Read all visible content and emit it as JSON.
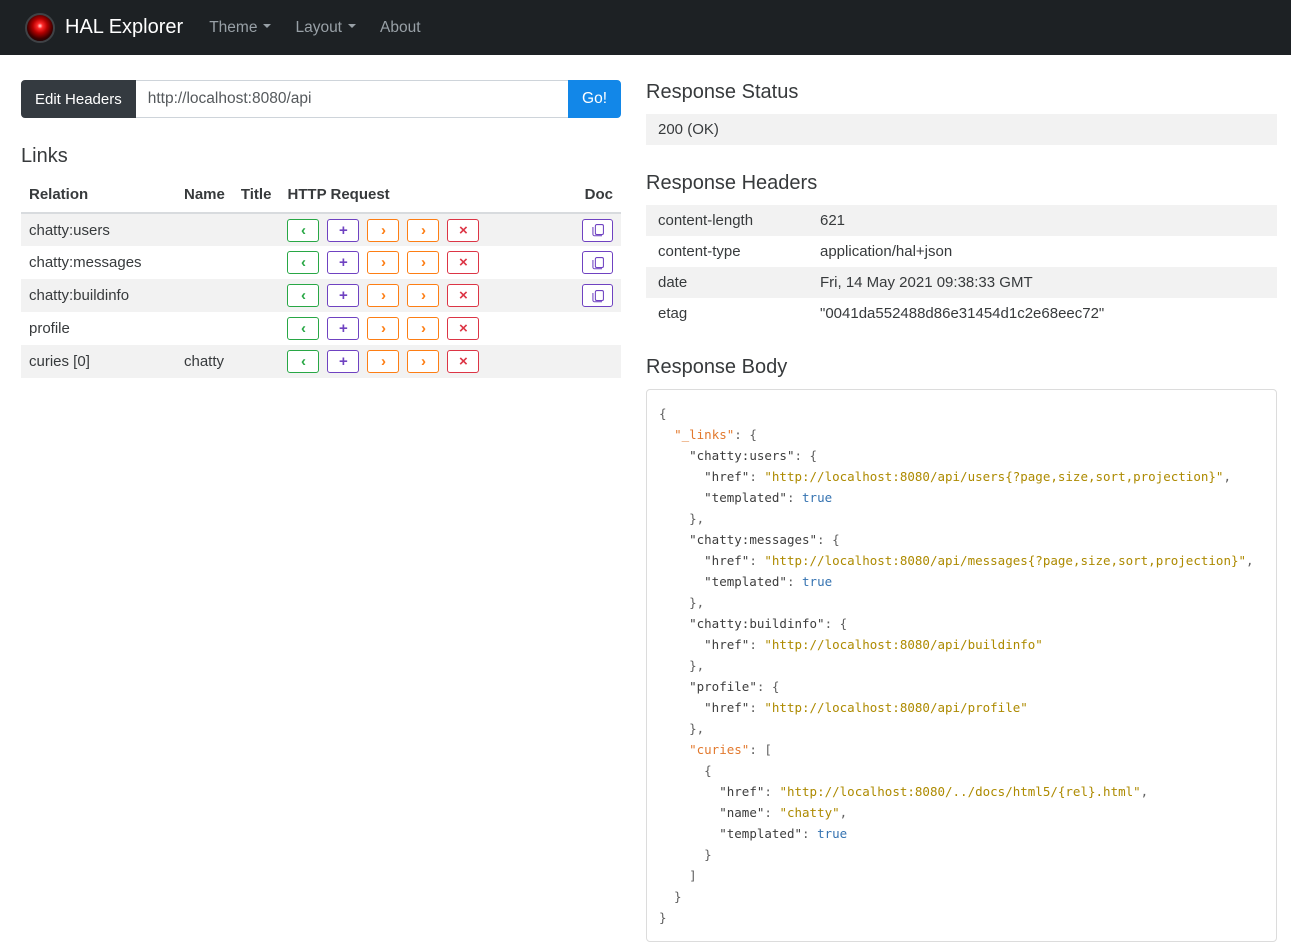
{
  "navbar": {
    "brand": "HAL Explorer",
    "items": [
      {
        "label": "Theme",
        "dropdown": true
      },
      {
        "label": "Layout",
        "dropdown": true
      },
      {
        "label": "About",
        "dropdown": false
      }
    ]
  },
  "address_bar": {
    "edit_headers_label": "Edit Headers",
    "url_value": "http://localhost:8080/api",
    "go_label": "Go!"
  },
  "links_section": {
    "title": "Links",
    "columns": [
      "Relation",
      "Name",
      "Title",
      "HTTP Request",
      "Doc"
    ],
    "http_buttons": [
      {
        "name": "get-button",
        "glyph": "‹",
        "color": "#28a745"
      },
      {
        "name": "post-button",
        "glyph": "+",
        "color": "#6f42c1"
      },
      {
        "name": "put-button",
        "glyph": "›",
        "color": "#fd7e14"
      },
      {
        "name": "patch-button",
        "glyph": "›",
        "color": "#fd7e14"
      },
      {
        "name": "delete-button",
        "glyph": "×",
        "color": "#dc3545"
      }
    ],
    "doc_button_color": "#6f42c1",
    "rows": [
      {
        "relation": "chatty:users",
        "name": "",
        "title": "",
        "doc": true
      },
      {
        "relation": "chatty:messages",
        "name": "",
        "title": "",
        "doc": true
      },
      {
        "relation": "chatty:buildinfo",
        "name": "",
        "title": "",
        "doc": true
      },
      {
        "relation": "profile",
        "name": "",
        "title": "",
        "doc": false
      },
      {
        "relation": "curies [0]",
        "name": "chatty",
        "title": "",
        "doc": false
      }
    ]
  },
  "response_status": {
    "title": "Response Status",
    "value": "200 (OK)"
  },
  "response_headers": {
    "title": "Response Headers",
    "rows": [
      {
        "key": "content-length",
        "value": "621"
      },
      {
        "key": "content-type",
        "value": "application/hal+json"
      },
      {
        "key": "date",
        "value": "Fri, 14 May 2021 09:38:33 GMT"
      },
      {
        "key": "etag",
        "value": "\"0041da552488d86e31454d1c2e68eec72\""
      }
    ]
  },
  "response_body": {
    "title": "Response Body",
    "token_colors": {
      "p": "#5f5f5f",
      "k": "#3d3d3d",
      "r": "#e2792e",
      "s": "#ad8a00",
      "b": "#3573b1"
    },
    "lines": [
      [
        [
          "p",
          "{"
        ]
      ],
      [
        [
          "p",
          "  "
        ],
        [
          "r",
          "\"_links\""
        ],
        [
          "p",
          ": {"
        ]
      ],
      [
        [
          "p",
          "    "
        ],
        [
          "k",
          "\"chatty:users\""
        ],
        [
          "p",
          ": {"
        ]
      ],
      [
        [
          "p",
          "      "
        ],
        [
          "k",
          "\"href\""
        ],
        [
          "p",
          ": "
        ],
        [
          "s",
          "\"http://localhost:8080/api/users{?page,size,sort,projection}\""
        ],
        [
          "p",
          ","
        ]
      ],
      [
        [
          "p",
          "      "
        ],
        [
          "k",
          "\"templated\""
        ],
        [
          "p",
          ": "
        ],
        [
          "b",
          "true"
        ]
      ],
      [
        [
          "p",
          "    },"
        ]
      ],
      [
        [
          "p",
          "    "
        ],
        [
          "k",
          "\"chatty:messages\""
        ],
        [
          "p",
          ": {"
        ]
      ],
      [
        [
          "p",
          "      "
        ],
        [
          "k",
          "\"href\""
        ],
        [
          "p",
          ": "
        ],
        [
          "s",
          "\"http://localhost:8080/api/messages{?page,size,sort,projection}\""
        ],
        [
          "p",
          ","
        ]
      ],
      [
        [
          "p",
          "      "
        ],
        [
          "k",
          "\"templated\""
        ],
        [
          "p",
          ": "
        ],
        [
          "b",
          "true"
        ]
      ],
      [
        [
          "p",
          "    },"
        ]
      ],
      [
        [
          "p",
          "    "
        ],
        [
          "k",
          "\"chatty:buildinfo\""
        ],
        [
          "p",
          ": {"
        ]
      ],
      [
        [
          "p",
          "      "
        ],
        [
          "k",
          "\"href\""
        ],
        [
          "p",
          ": "
        ],
        [
          "s",
          "\"http://localhost:8080/api/buildinfo\""
        ]
      ],
      [
        [
          "p",
          "    },"
        ]
      ],
      [
        [
          "p",
          "    "
        ],
        [
          "k",
          "\"profile\""
        ],
        [
          "p",
          ": {"
        ]
      ],
      [
        [
          "p",
          "      "
        ],
        [
          "k",
          "\"href\""
        ],
        [
          "p",
          ": "
        ],
        [
          "s",
          "\"http://localhost:8080/api/profile\""
        ]
      ],
      [
        [
          "p",
          "    },"
        ]
      ],
      [
        [
          "p",
          "    "
        ],
        [
          "r",
          "\"curies\""
        ],
        [
          "p",
          ": ["
        ]
      ],
      [
        [
          "p",
          "      {"
        ]
      ],
      [
        [
          "p",
          "        "
        ],
        [
          "k",
          "\"href\""
        ],
        [
          "p",
          ": "
        ],
        [
          "s",
          "\"http://localhost:8080/../docs/html5/{rel}.html\""
        ],
        [
          "p",
          ","
        ]
      ],
      [
        [
          "p",
          "        "
        ],
        [
          "k",
          "\"name\""
        ],
        [
          "p",
          ": "
        ],
        [
          "s",
          "\"chatty\""
        ],
        [
          "p",
          ","
        ]
      ],
      [
        [
          "p",
          "        "
        ],
        [
          "k",
          "\"templated\""
        ],
        [
          "p",
          ": "
        ],
        [
          "b",
          "true"
        ]
      ],
      [
        [
          "p",
          "      }"
        ]
      ],
      [
        [
          "p",
          "    ]"
        ]
      ],
      [
        [
          "p",
          "  }"
        ]
      ],
      [
        [
          "p",
          "}"
        ]
      ]
    ]
  },
  "colors": {
    "navbar_bg": "#1d2124",
    "primary": "#1287e8",
    "edit_headers_bg": "#343a40",
    "stripe": "#f2f2f2",
    "get": "#28a745",
    "post": "#6f42c1",
    "put": "#fd7e14",
    "patch": "#fd7e14",
    "delete": "#dc3545",
    "doc": "#6f42c1"
  }
}
